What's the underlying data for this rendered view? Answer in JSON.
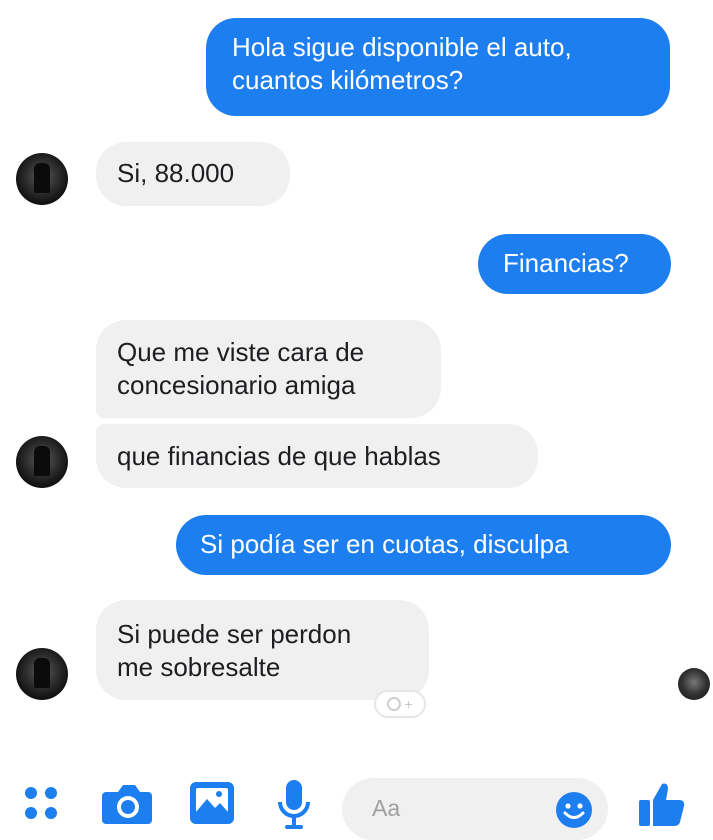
{
  "conversation": {
    "messages": [
      {
        "direction": "sent",
        "lines": [
          "Hola sigue disponible el auto,",
          "cuantos kilómetros?"
        ]
      },
      {
        "direction": "received",
        "lines": [
          "Si, 88.000"
        ]
      },
      {
        "direction": "sent",
        "lines": [
          "Financias?"
        ]
      },
      {
        "direction": "received",
        "lines": [
          "Que me viste cara de",
          "concesionario amiga"
        ]
      },
      {
        "direction": "received",
        "lines": [
          "que financias de que hablas"
        ]
      },
      {
        "direction": "sent",
        "lines": [
          "Si podía ser en cuotas, disculpa"
        ]
      },
      {
        "direction": "received",
        "lines": [
          "Si puede ser perdon",
          "me sobresalte"
        ]
      }
    ]
  },
  "composer": {
    "placeholder": "Aa",
    "icons": [
      "apps-icon",
      "camera-icon",
      "image-icon",
      "microphone-icon",
      "emoji-icon",
      "thumbs-up-icon"
    ]
  },
  "colors": {
    "sent_bubble": "#1d7ef0",
    "received_bubble": "#f1f0f0",
    "accent": "#1d7ef0"
  }
}
